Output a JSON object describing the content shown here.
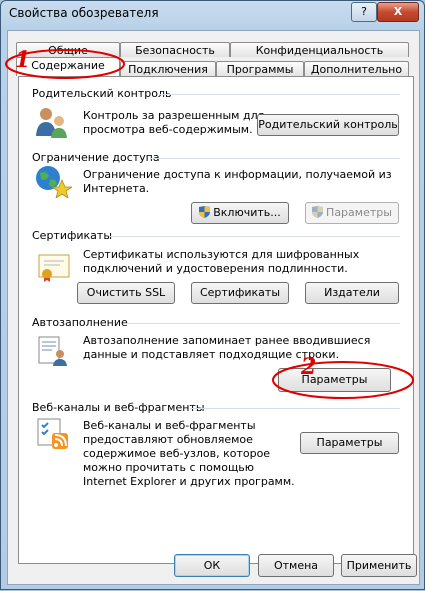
{
  "window": {
    "title": "Свойства обозревателя",
    "help_label": "?",
    "close_label": "X"
  },
  "tabs": {
    "row1": [
      "Общие",
      "Безопасность",
      "Конфиденциальность"
    ],
    "row2": [
      "Содержание",
      "Подключения",
      "Программы",
      "Дополнительно"
    ]
  },
  "sections": {
    "parental": {
      "title": "Родительский контроль",
      "desc": [
        "Контроль за разрешенным для",
        "просмотра веб-содержимым."
      ],
      "button": "Родительский контроль"
    },
    "access": {
      "title": "Ограничение доступа",
      "desc": [
        "Ограничение доступа к информации, получаемой из",
        "Интернета."
      ],
      "enable_button": "Включить...",
      "params_button": "Параметры"
    },
    "certs": {
      "title": "Сертификаты",
      "desc": [
        "Сертификаты используются для шифрованных",
        "подключений и удостоверения подлинности."
      ],
      "clear_ssl": "Очистить SSL",
      "certificates": "Сертификаты",
      "publishers": "Издатели"
    },
    "autocomplete": {
      "title": "Автозаполнение",
      "desc": [
        "Автозаполнение запоминает ранее вводившиеся",
        "данные и подставляет подходящие строки."
      ],
      "params_button": "Параметры"
    },
    "feeds": {
      "title": "Веб-каналы и веб-фрагменты",
      "desc": [
        "Веб-каналы и веб-фрагменты",
        "предоставляют обновляемое",
        "содержимое веб-узлов, которое",
        "можно прочитать с помощью",
        "Internet Explorer и других программ."
      ],
      "params_button": "Параметры"
    }
  },
  "footer": {
    "ok": "ОК",
    "cancel": "Отмена",
    "apply": "Применить"
  },
  "annotations": {
    "step1": "1",
    "step2": "2",
    "color": "#e00000"
  }
}
